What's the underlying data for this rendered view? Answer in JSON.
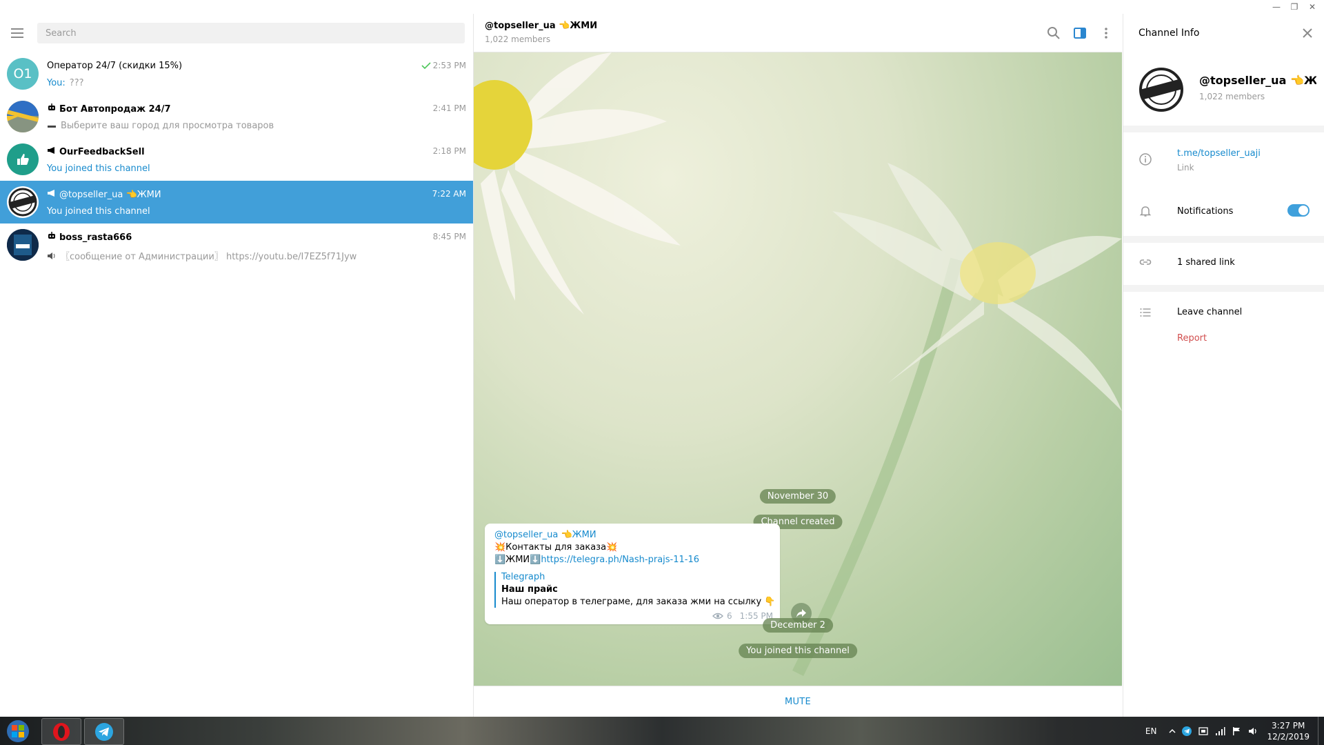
{
  "window": {
    "controls": [
      "—",
      "❐",
      "✕"
    ]
  },
  "search": {
    "placeholder": "Search"
  },
  "chats": [
    {
      "title": "Оператор 24/7 (скидки 15%)",
      "time": "2:53 PM",
      "prefix": "You:",
      "message": "???",
      "avatar_text": "O1",
      "avatar_color": "#59c0c5",
      "type": "user",
      "read_check": true
    },
    {
      "title": "Бот Автопродаж 24/7",
      "time": "2:41 PM",
      "prefix": "",
      "message": "Выберите ваш город для просмотра товаров",
      "type": "bot"
    },
    {
      "title": "OurFeedbackSell",
      "time": "2:18 PM",
      "prefix": "",
      "message": "You joined this channel",
      "type": "channel"
    },
    {
      "title": "@topseller_ua 👈ЖМИ",
      "time": "7:22 AM",
      "prefix": "",
      "message": "You joined this channel",
      "type": "channel",
      "active": true
    },
    {
      "title": "boss_rasta666",
      "time": "8:45 PM",
      "prefix": "",
      "message": "〖сообщение от Администрации〗 https://youtu.be/I7EZ5f71Jyw",
      "type": "bot"
    }
  ],
  "header": {
    "title": "@topseller_ua 👈ЖМИ",
    "subtitle": "1,022 members"
  },
  "messages": {
    "date1": "November 30",
    "service1": "Channel created",
    "post": {
      "author": "@topseller_ua 👈ЖМИ",
      "line1": "💥Контакты для заказа💥",
      "line2_prefix": "⬇️ЖМИ⬇️",
      "line2_link": "https://telegra.ph/Nash-prajs-11-16",
      "preview_site": "Telegraph",
      "preview_title": "Наш прайс",
      "preview_desc": "Наш оператор в телеграме, для заказа  жми на ссылку 👇",
      "views": "6",
      "time": "1:55 PM"
    },
    "date2": "December 2",
    "service2": "You joined this channel"
  },
  "bottom": {
    "mute_label": "MUTE"
  },
  "info": {
    "title": "Channel Info",
    "name": "@topseller_ua 👈ЖМИ",
    "members": "1,022 members",
    "link": "t.me/topseller_uaji",
    "link_label": "Link",
    "notifications_label": "Notifications",
    "notifications_on": true,
    "shared_links": "1 shared link",
    "leave": "Leave channel",
    "report": "Report"
  },
  "taskbar": {
    "lang": "EN",
    "time": "3:27 PM",
    "date": "12/2/2019"
  },
  "colors": {
    "accent": "#419fd9",
    "link": "#168acd",
    "report": "#d14e4e"
  }
}
